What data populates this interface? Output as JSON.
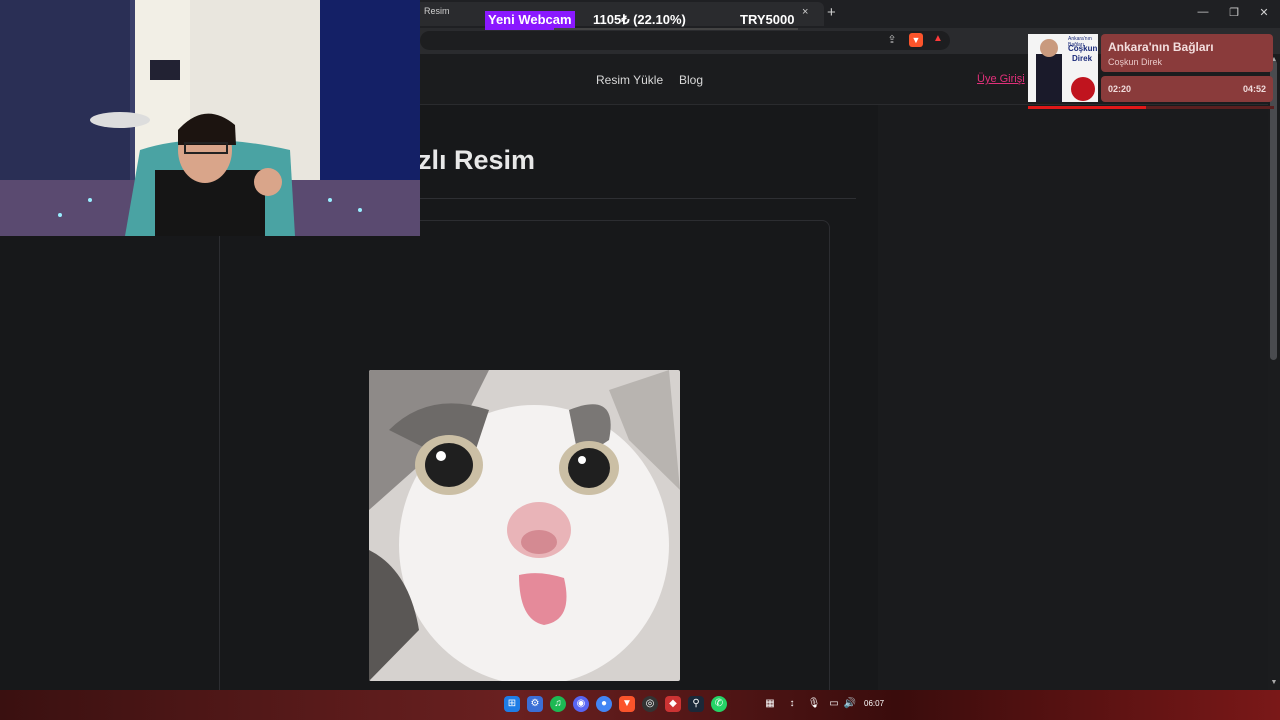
{
  "browser": {
    "tab_title": "Resim",
    "tab_close": "×",
    "new_tab": "+",
    "window_controls": [
      "—",
      "❐",
      "✕"
    ]
  },
  "site": {
    "nav": [
      "Resim Yükle",
      "Blog"
    ],
    "login": "Üye Girişi",
    "page_title": "zlı Resim"
  },
  "overlay": {
    "badge": "Yeni Webcam",
    "goal_amount": "1105₺ (22.10%)",
    "goal_target": "TRY5000",
    "goal_progress": 0.221
  },
  "music": {
    "title": "Ankara'nın Bağları",
    "artist": "Coşkun Direk",
    "album_text_1": "Ankara'nın Bağları",
    "album_text_2": "Coşkun",
    "album_text_3": "Direk",
    "current_time": "02:20",
    "total_time": "04:52",
    "progress": 0.48
  },
  "taskbar": {
    "clock": "06:07",
    "apps": [
      "windows-icon",
      "settings-icon",
      "spotify-icon",
      "discord-icon",
      "chrome-icon",
      "brave-icon",
      "obs-icon",
      "app-icon",
      "steam-icon",
      "whatsapp-icon"
    ]
  },
  "colors": {
    "accent_login": "#e1307a",
    "overlay_badge": "#8a18ff",
    "music_card": "#8a3b3b"
  }
}
